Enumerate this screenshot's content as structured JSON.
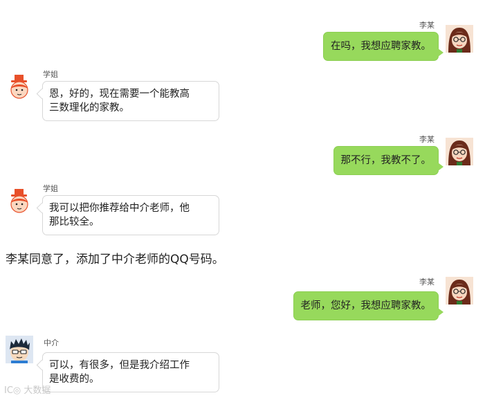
{
  "messages": [
    {
      "name": "李某",
      "text": "在吗，我想应聘家教。"
    },
    {
      "name": "学姐",
      "text": "恩，好的，现在需要一个能教高\n三数理化的家教。"
    },
    {
      "name": "李某",
      "text": "那不行，我教不了。"
    },
    {
      "name": "学姐",
      "text": "我可以把你推荐给中介老师，他\n那比较全。"
    },
    {
      "narration": "李某同意了，添加了中介老师的QQ号码。"
    },
    {
      "name": "李某",
      "text": "老师，您好，我想应聘家教。"
    },
    {
      "name": "中介",
      "text": "可以，有很多，但是我介绍工作\n是收费的。"
    }
  ],
  "colors": {
    "right_bubble": "#97d95c",
    "left_bubble": "#ffffff"
  },
  "watermark": "大数据"
}
